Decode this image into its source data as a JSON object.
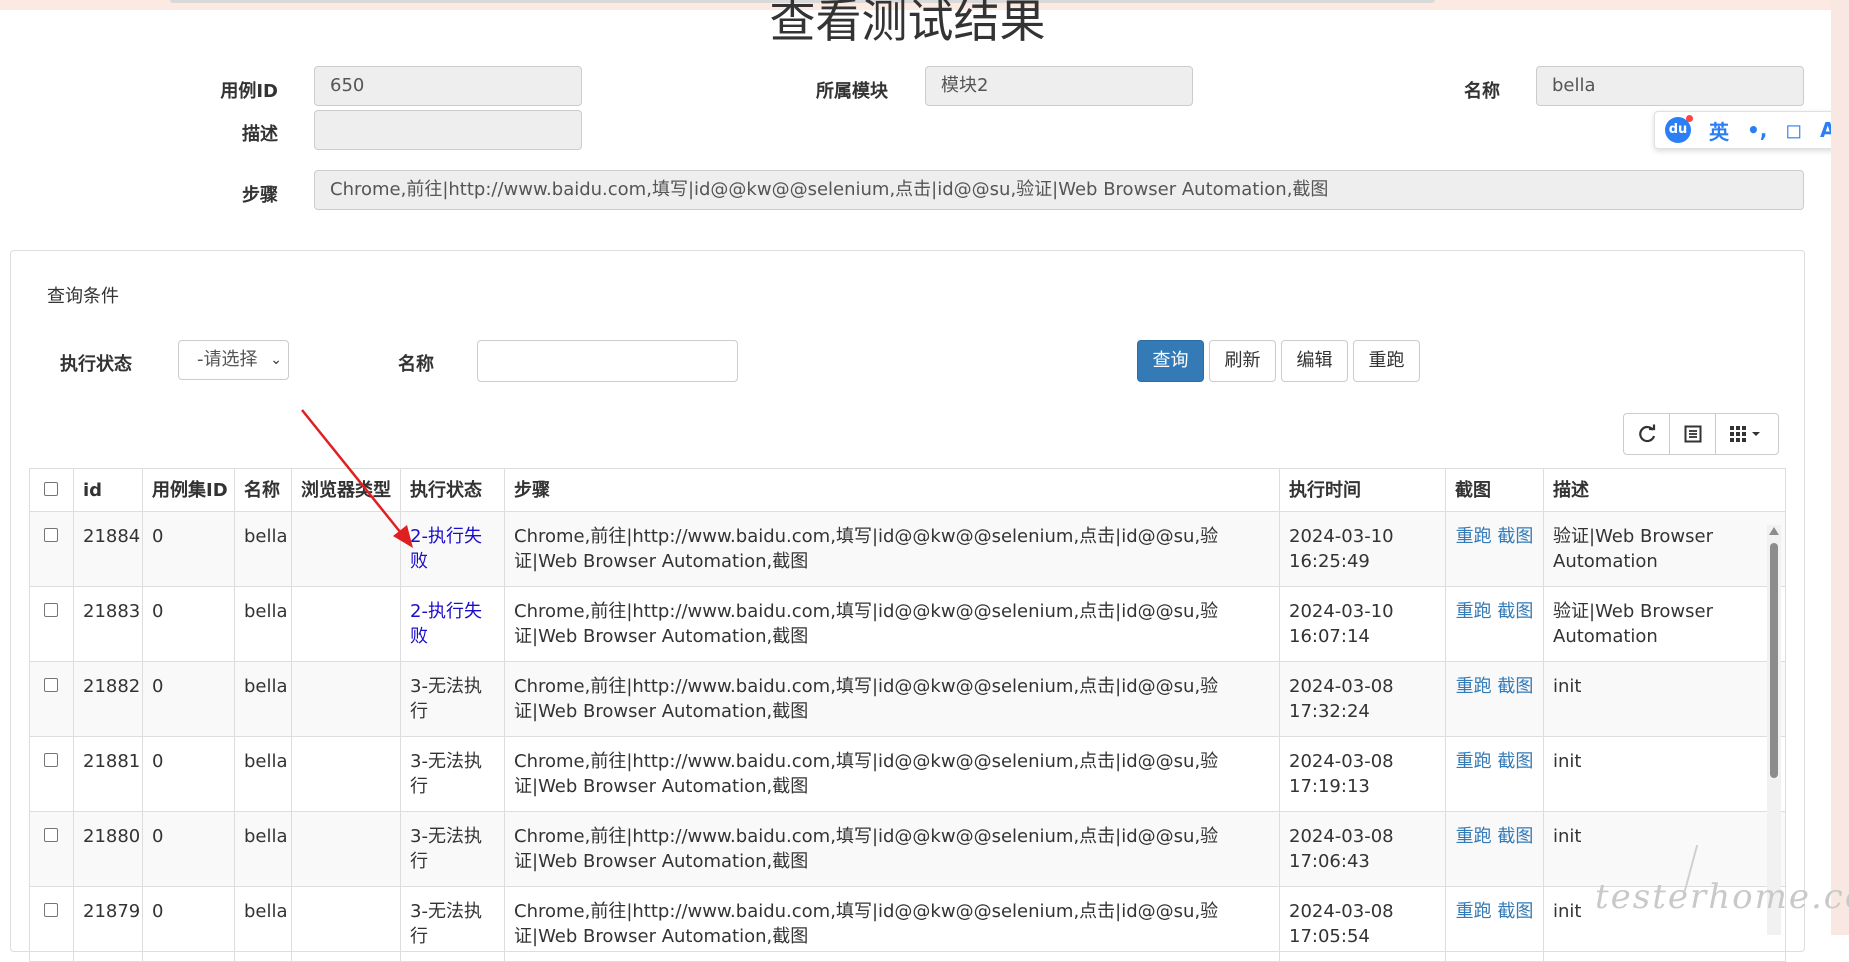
{
  "page": {
    "title": "查看测试结果"
  },
  "case_info": {
    "id_label": "用例ID",
    "id_value": "650",
    "module_label": "所属模块",
    "module_value": "模块2",
    "name_label": "名称",
    "name_value": "bella",
    "desc_label": "描述",
    "desc_value": "",
    "steps_label": "步骤",
    "steps_value": "Chrome,前往|http://www.baidu.com,填写|id@@kw@@selenium,点击|id@@su,验证|Web Browser Automation,截图"
  },
  "query": {
    "title": "查询条件",
    "status_label": "执行状态",
    "status_selected": "-请选择",
    "name_label": "名称",
    "name_value": "",
    "buttons": {
      "search": "查询",
      "refresh": "刷新",
      "edit": "编辑",
      "rerun": "重跑"
    }
  },
  "toolbar": {
    "icons": [
      "refresh-icon",
      "list-icon",
      "columns-grid-icon"
    ]
  },
  "table": {
    "headers": [
      "id",
      "用例集ID",
      "名称",
      "浏览器类型",
      "执行状态",
      "步骤",
      "执行时间",
      "截图",
      "描述"
    ],
    "rows": [
      {
        "id": "21884",
        "suite_id": "0",
        "name": "bella",
        "browser": "",
        "status": "2-执行失败",
        "steps": "Chrome,前往|http://www.baidu.com,填写|id@@kw@@selenium,点击|id@@su,验证|Web Browser Automation,截图",
        "time": "2024-03-10 16:25:49",
        "rerun": "重跑",
        "shot": "截图",
        "desc": "验证|Web Browser Automation"
      },
      {
        "id": "21883",
        "suite_id": "0",
        "name": "bella",
        "browser": "",
        "status": "2-执行失败",
        "steps": "Chrome,前往|http://www.baidu.com,填写|id@@kw@@selenium,点击|id@@su,验证|Web Browser Automation,截图",
        "time": "2024-03-10 16:07:14",
        "rerun": "重跑",
        "shot": "截图",
        "desc": "验证|Web Browser Automation"
      },
      {
        "id": "21882",
        "suite_id": "0",
        "name": "bella",
        "browser": "",
        "status": "3-无法执行",
        "steps": "Chrome,前往|http://www.baidu.com,填写|id@@kw@@selenium,点击|id@@su,验证|Web Browser Automation,截图",
        "time": "2024-03-08 17:32:24",
        "rerun": "重跑",
        "shot": "截图",
        "desc": "init"
      },
      {
        "id": "21881",
        "suite_id": "0",
        "name": "bella",
        "browser": "",
        "status": "3-无法执行",
        "steps": "Chrome,前往|http://www.baidu.com,填写|id@@kw@@selenium,点击|id@@su,验证|Web Browser Automation,截图",
        "time": "2024-03-08 17:19:13",
        "rerun": "重跑",
        "shot": "截图",
        "desc": "init"
      },
      {
        "id": "21880",
        "suite_id": "0",
        "name": "bella",
        "browser": "",
        "status": "3-无法执行",
        "steps": "Chrome,前往|http://www.baidu.com,填写|id@@kw@@selenium,点击|id@@su,验证|Web Browser Automation,截图",
        "time": "2024-03-08 17:06:43",
        "rerun": "重跑",
        "shot": "截图",
        "desc": "init"
      },
      {
        "id": "21879",
        "suite_id": "0",
        "name": "bella",
        "browser": "",
        "status": "3-无法执行",
        "steps": "Chrome,前往|http://www.baidu.com,填写|id@@kw@@selenium,点击|id@@su,验证|Web Browser Automation,截图",
        "time": "2024-03-08 17:05:54",
        "rerun": "重跑",
        "shot": "截图",
        "desc": "init"
      }
    ]
  },
  "ime": {
    "logo": "du",
    "lang": "英",
    "items": [
      "punctuation-icon",
      "fullwidth-icon",
      "font-icon",
      "emoji-icon"
    ]
  },
  "watermark": "testerhome.com",
  "colors": {
    "primary": "#337ab7",
    "fail_link": "#1a0dcc",
    "arrow": "#e02020"
  }
}
